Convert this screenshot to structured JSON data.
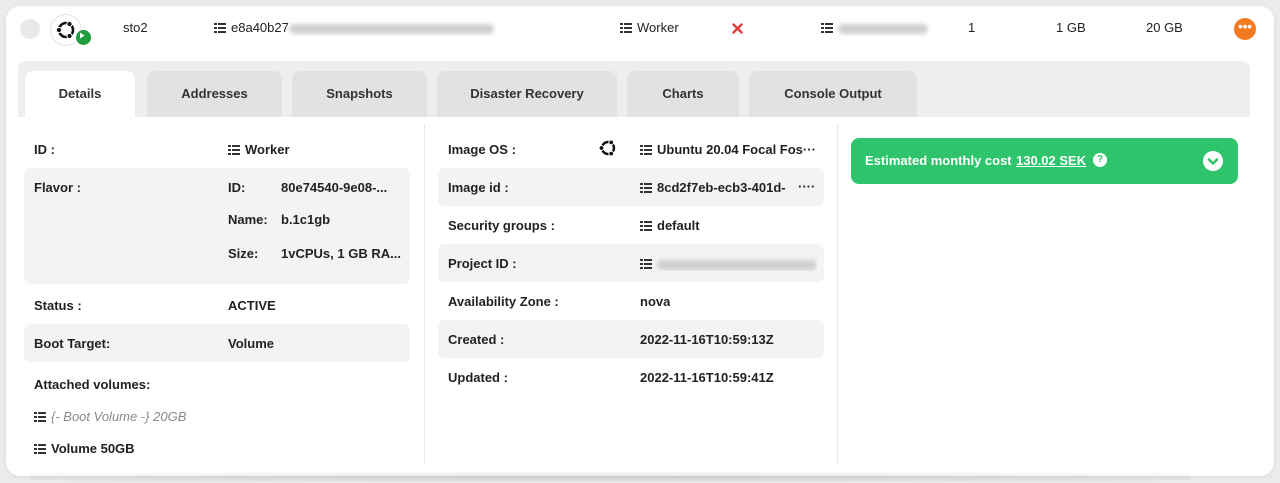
{
  "server_row": {
    "name": "sto2",
    "id_prefix": "e8a40b27",
    "group": "Worker",
    "disk_count": "1",
    "ram": "1 GB",
    "disk": "20 GB",
    "menu_glyph": "•••",
    "colors": {
      "active_badge": "#1e9e3c",
      "menu": "#f47a1f",
      "error": "#e23b3b"
    }
  },
  "tabs": [
    {
      "label": "Details",
      "active": true
    },
    {
      "label": "Addresses"
    },
    {
      "label": "Snapshots"
    },
    {
      "label": "Disaster Recovery"
    },
    {
      "label": "Charts"
    },
    {
      "label": "Console Output"
    }
  ],
  "details": {
    "id_label": "ID :",
    "id_value": "Worker",
    "flavor_label": "Flavor :",
    "flavor_id_label": "ID:",
    "flavor_id_value": "80e74540-9e08-...",
    "flavor_name_label": "Name:",
    "flavor_name_value": "b.1c1gb",
    "flavor_size_label": "Size:",
    "flavor_size_value": "1vCPUs, 1 GB RA...",
    "status_label": "Status :",
    "status_value": "ACTIVE",
    "boot_label": "Boot Target:",
    "boot_value": "Volume",
    "attached_label": "Attached volumes:",
    "volumes": [
      "{- Boot Volume -} 20GB",
      "Volume 50GB"
    ]
  },
  "image": {
    "os_label": "Image OS :",
    "os_value": "Ubuntu 20.04 Focal Fos···",
    "id_label": "Image id :",
    "id_value": "8cd2f7eb-ecb3-401d-",
    "id_more": "····",
    "sg_label": "Security groups :",
    "sg_value": "default",
    "project_label": "Project ID :",
    "az_label": "Availability Zone :",
    "az_value": "nova",
    "created_label": "Created :",
    "created_value": "2022-11-16T10:59:13Z",
    "updated_label": "Updated :",
    "updated_value": "2022-11-16T10:59:41Z"
  },
  "cost": {
    "label": "Estimated monthly cost",
    "value": "130.02 SEK",
    "help_glyph": "?",
    "color": "#2ec46b"
  },
  "icons": {
    "os": "ubuntu-logo-icon",
    "status": "play-icon",
    "grid": "grid-list-icon",
    "cross": "close-icon",
    "help": "question-icon",
    "chevron": "chevron-down-icon"
  }
}
